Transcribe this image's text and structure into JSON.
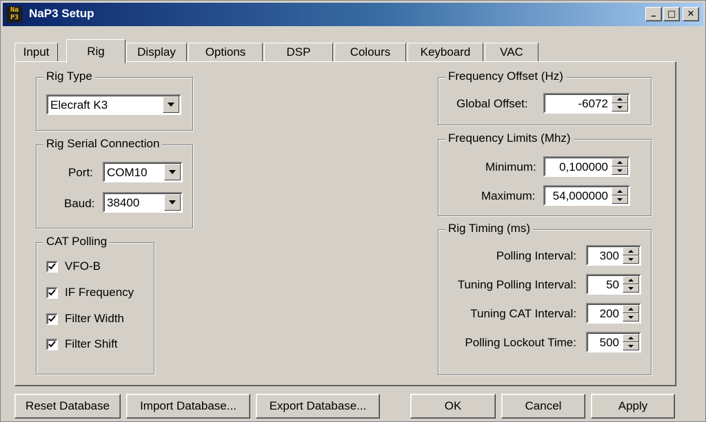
{
  "window": {
    "title": "NaP3 Setup",
    "icon_letters": [
      "Na",
      "P3"
    ]
  },
  "titlebar_buttons": {
    "minimize": "_",
    "maximize": "□",
    "close": "✕"
  },
  "tabs": [
    {
      "label": "Input"
    },
    {
      "label": "Rig",
      "active": true
    },
    {
      "label": "Display"
    },
    {
      "label": "Options"
    },
    {
      "label": "DSP"
    },
    {
      "label": "Colours"
    },
    {
      "label": "Keyboard"
    },
    {
      "label": "VAC"
    }
  ],
  "rig_type": {
    "title": "Rig Type",
    "selected": "Elecraft K3"
  },
  "serial": {
    "title": "Rig Serial Connection",
    "port_label": "Port:",
    "port_value": "COM10",
    "baud_label": "Baud:",
    "baud_value": "38400"
  },
  "cat_polling": {
    "title": "CAT Polling",
    "items": [
      {
        "label": "VFO-B",
        "checked": true
      },
      {
        "label": "IF Frequency",
        "checked": true
      },
      {
        "label": "Filter Width",
        "checked": true
      },
      {
        "label": "Filter Shift",
        "checked": true
      }
    ]
  },
  "freq_offset": {
    "title": "Frequency Offset  (Hz)",
    "label": "Global Offset:",
    "value": "-6072"
  },
  "freq_limits": {
    "title": "Frequency Limits (Mhz)",
    "min_label": "Minimum:",
    "min_value": "0,100000",
    "max_label": "Maximum:",
    "max_value": "54,000000"
  },
  "rig_timing": {
    "title": "Rig Timing (ms)",
    "items": [
      {
        "label": "Polling Interval:",
        "value": "300"
      },
      {
        "label": "Tuning Polling Interval:",
        "value": "50"
      },
      {
        "label": "Tuning CAT Interval:",
        "value": "200"
      },
      {
        "label": "Polling Lockout Time:",
        "value": "500"
      }
    ]
  },
  "buttons": {
    "reset": "Reset Database",
    "import": "Import Database...",
    "export": "Export Database...",
    "ok": "OK",
    "cancel": "Cancel",
    "apply": "Apply"
  }
}
